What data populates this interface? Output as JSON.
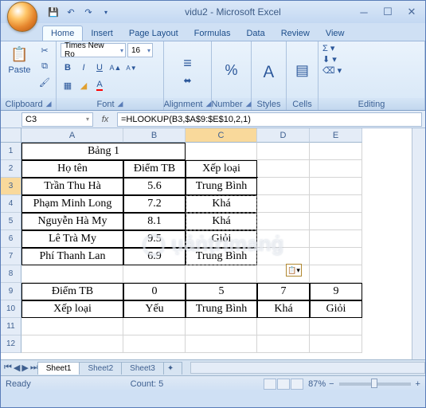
{
  "title": "vidu2 - Microsoft Excel",
  "tabs": {
    "home": "Home",
    "insert": "Insert",
    "page": "Page Layout",
    "formulas": "Formulas",
    "data": "Data",
    "review": "Review",
    "view": "View"
  },
  "ribbon": {
    "clipboard": {
      "label": "Clipboard",
      "paste": "Paste"
    },
    "font": {
      "label": "Font",
      "family": "Times New Ro",
      "size": "16"
    },
    "alignment": {
      "label": "Alignment"
    },
    "number": {
      "label": "Number"
    },
    "styles": {
      "label": "Styles"
    },
    "cells": {
      "label": "Cells"
    },
    "editing": {
      "label": "Editing"
    }
  },
  "namebox": "C3",
  "formula": "=HLOOKUP(B3,$A$9:$E$10,2,1)",
  "headers": {
    "A": "A",
    "B": "B",
    "C": "C",
    "D": "D",
    "E": "E"
  },
  "rows": {
    "r1": {
      "A": "Bảng 1"
    },
    "r2": {
      "A": "Họ tên",
      "B": "Điểm TB",
      "C": "Xếp loại"
    },
    "r3": {
      "A": "Trần Thu Hà",
      "B": "5.6",
      "C": "Trung Bình"
    },
    "r4": {
      "A": "Phạm Minh Long",
      "B": "7.2",
      "C": "Khá"
    },
    "r5": {
      "A": "Nguyễn Hà My",
      "B": "8.1",
      "C": "Khá"
    },
    "r6": {
      "A": "Lê Trà My",
      "B": "9.5",
      "C": "Giỏi"
    },
    "r7": {
      "A": "Phí Thanh Lan",
      "B": "6.9",
      "C": "Trung Bình"
    },
    "r9": {
      "A": "Điểm TB",
      "B": "0",
      "C": "5",
      "D": "7",
      "E": "9"
    },
    "r10": {
      "A": "Xếp loại",
      "B": "Yếu",
      "C": "Trung Bình",
      "D": "Khá",
      "E": "Giỏi"
    }
  },
  "sheetTabs": {
    "s1": "Sheet1",
    "s2": "Sheet2",
    "s3": "Sheet3"
  },
  "status": {
    "ready": "Ready",
    "count": "Count: 5",
    "zoom": "87%"
  }
}
